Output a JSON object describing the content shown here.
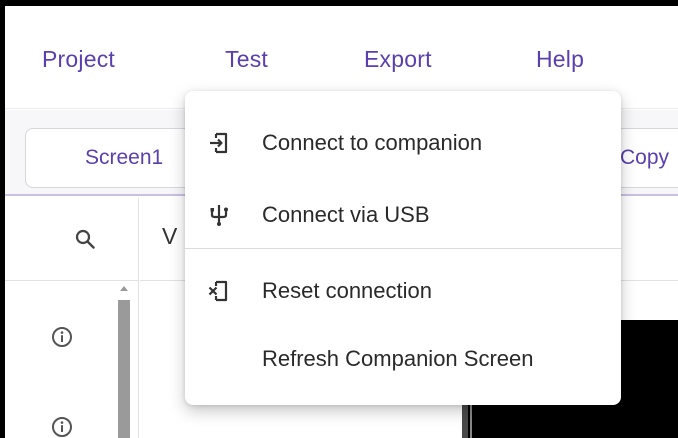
{
  "menubar": {
    "items": [
      "Project",
      "Test",
      "Export",
      "Help"
    ]
  },
  "toolbar": {
    "screen_label": "Screen1",
    "copy_label": "Copy"
  },
  "designer": {
    "viewer_partial": "V"
  },
  "test_menu": {
    "items": [
      {
        "label": "Connect to companion",
        "icon": "companion-connect-icon"
      },
      {
        "label": "Connect via USB",
        "icon": "usb-icon"
      },
      {
        "label": "Reset connection",
        "icon": "reset-connection-icon"
      },
      {
        "label": "Refresh Companion Screen",
        "icon": ""
      }
    ]
  },
  "colors": {
    "accent": "#5b3fae",
    "text": "#2a2a2a",
    "divider": "#c9c0e4"
  }
}
